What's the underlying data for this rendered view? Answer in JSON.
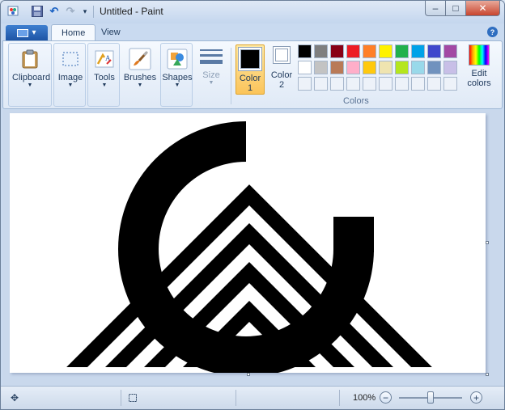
{
  "window": {
    "title": "Untitled - Paint"
  },
  "quick_access": {
    "icons": [
      "paint-app-icon",
      "save-icon",
      "undo-icon",
      "redo-icon",
      "customize-dropdown-icon"
    ]
  },
  "window_buttons": {
    "minimize": "–",
    "maximize": "□",
    "close": "✕"
  },
  "tabs": [
    {
      "label": "Home",
      "active": true
    },
    {
      "label": "View",
      "active": false
    }
  ],
  "help": "?",
  "ribbon": {
    "groups": [
      {
        "id": "clipboard",
        "label": "Clipboard"
      },
      {
        "id": "image",
        "label": "Image"
      },
      {
        "id": "tools",
        "label": "Tools"
      },
      {
        "id": "brushes",
        "label": "Brushes"
      },
      {
        "id": "shapes",
        "label": "Shapes"
      },
      {
        "id": "size",
        "label": "Size",
        "disabled": true
      }
    ],
    "color1": {
      "label_line1": "Color",
      "label_line2": "1",
      "value": "#000000"
    },
    "color2": {
      "label_line1": "Color",
      "label_line2": "2",
      "value": "#ffffff"
    },
    "colors_label": "Colors",
    "edit_colors": {
      "line1": "Edit",
      "line2": "colors"
    },
    "palette_row1": [
      "#000000",
      "#7f7f7f",
      "#880015",
      "#ed1c24",
      "#ff7f27",
      "#fff200",
      "#22b14c",
      "#00a2e8",
      "#3f48cc",
      "#a349a4"
    ],
    "palette_row2": [
      "#ffffff",
      "#c3c3c3",
      "#b97a57",
      "#ffaec9",
      "#ffc90e",
      "#efe4b0",
      "#b5e61d",
      "#99d9ea",
      "#7092be",
      "#c8bfe7"
    ],
    "palette_row3_empty": 10
  },
  "canvas": {
    "image": "black-white-geometric-logo-circle-and-stripes"
  },
  "status": {
    "zoom": "100%",
    "zoom_level": 1.0
  }
}
